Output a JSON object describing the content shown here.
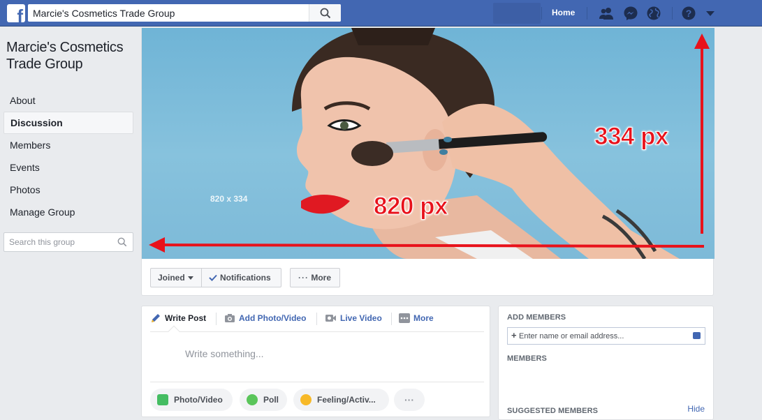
{
  "topbar": {
    "logo_letter": "f",
    "search_value": "Marcie's Cosmetics Trade Group",
    "home_label": "Home",
    "accent": "#4267b2"
  },
  "group": {
    "name_line1": "Marcie's Cosmetics",
    "name_line2": "Trade Group"
  },
  "left_nav": {
    "items": [
      {
        "label": "About"
      },
      {
        "label": "Discussion",
        "active": true
      },
      {
        "label": "Members"
      },
      {
        "label": "Events"
      },
      {
        "label": "Photos"
      },
      {
        "label": "Manage Group"
      }
    ],
    "search_placeholder": "Search this group"
  },
  "cover": {
    "size_text": "820 x 334",
    "height_annotation": "334 px",
    "width_annotation": "820 px",
    "annotation_color": "#e8121b"
  },
  "cover_actions": {
    "joined_label": "Joined",
    "notifications_label": "Notifications",
    "more_label": "More"
  },
  "composer": {
    "tabs": [
      {
        "label": "Write Post",
        "icon": "pencil-icon"
      },
      {
        "label": "Add Photo/Video",
        "icon": "camera-icon"
      },
      {
        "label": "Live Video",
        "icon": "video-camera-icon"
      },
      {
        "label": "More",
        "icon": "more-dots-icon"
      }
    ],
    "placeholder": "Write something...",
    "pills": [
      {
        "label": "Photo/Video",
        "icon": "photo-icon"
      },
      {
        "label": "Poll",
        "icon": "poll-icon"
      },
      {
        "label": "Feeling/Activ...",
        "icon": "feeling-smiley-icon"
      },
      {
        "label": "···",
        "icon": "more-dots-icon"
      }
    ]
  },
  "members_panel": {
    "add_members_heading": "ADD MEMBERS",
    "add_placeholder": "Enter name or email address...",
    "add_plus": "+",
    "members_heading": "MEMBERS",
    "suggested_heading": "SUGGESTED MEMBERS",
    "hide_label": "Hide"
  }
}
